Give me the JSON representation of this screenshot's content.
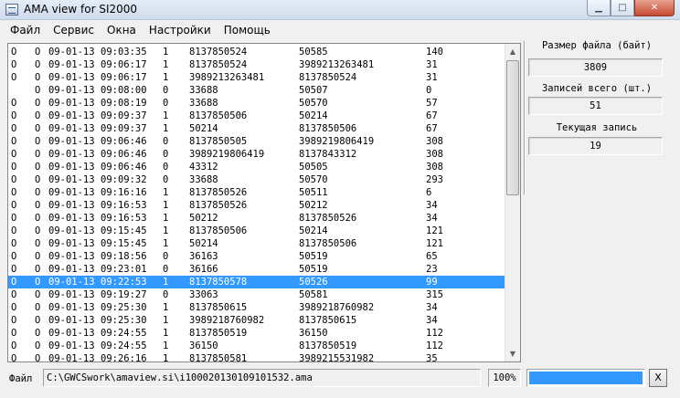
{
  "window": {
    "title": "AMA view for SI2000",
    "icon": "app-window-icon"
  },
  "menu": [
    "Файл",
    "Сервис",
    "Окна",
    "Настройки",
    "Помощь"
  ],
  "records": [
    [
      "O",
      "O",
      "09-01-13",
      "09:03:35",
      "1",
      "8137850524",
      "50585",
      "140"
    ],
    [
      "O",
      "O",
      "09-01-13",
      "09:06:17",
      "1",
      "8137850524",
      "3989213263481",
      "31"
    ],
    [
      "O",
      "O",
      "09-01-13",
      "09:06:17",
      "1",
      "3989213263481",
      "8137850524",
      "31"
    ],
    [
      "",
      "O",
      "09-01-13",
      "09:08:00",
      "0",
      "33688",
      "50507",
      "0"
    ],
    [
      "O",
      "O",
      "09-01-13",
      "09:08:19",
      "0",
      "33688",
      "50570",
      "57"
    ],
    [
      "O",
      "O",
      "09-01-13",
      "09:09:37",
      "1",
      "8137850506",
      "50214",
      "67"
    ],
    [
      "O",
      "O",
      "09-01-13",
      "09:09:37",
      "1",
      "50214",
      "8137850506",
      "67"
    ],
    [
      "O",
      "O",
      "09-01-13",
      "09:06:46",
      "0",
      "8137850505",
      "3989219806419",
      "308"
    ],
    [
      "O",
      "O",
      "09-01-13",
      "09:06:46",
      "0",
      "3989219806419",
      "8137843312",
      "308"
    ],
    [
      "O",
      "O",
      "09-01-13",
      "09:06:46",
      "0",
      "43312",
      "50505",
      "308"
    ],
    [
      "O",
      "O",
      "09-01-13",
      "09:09:32",
      "0",
      "33688",
      "50570",
      "293"
    ],
    [
      "O",
      "O",
      "09-01-13",
      "09:16:16",
      "1",
      "8137850526",
      "50511",
      "6"
    ],
    [
      "O",
      "O",
      "09-01-13",
      "09:16:53",
      "1",
      "8137850526",
      "50212",
      "34"
    ],
    [
      "O",
      "O",
      "09-01-13",
      "09:16:53",
      "1",
      "50212",
      "8137850526",
      "34"
    ],
    [
      "O",
      "O",
      "09-01-13",
      "09:15:45",
      "1",
      "8137850506",
      "50214",
      "121"
    ],
    [
      "O",
      "O",
      "09-01-13",
      "09:15:45",
      "1",
      "50214",
      "8137850506",
      "121"
    ],
    [
      "O",
      "O",
      "09-01-13",
      "09:18:56",
      "0",
      "36163",
      "50519",
      "65"
    ],
    [
      "O",
      "O",
      "09-01-13",
      "09:23:01",
      "0",
      "36166",
      "50519",
      "23"
    ],
    [
      "O",
      "O",
      "09-01-13",
      "09:22:53",
      "1",
      "8137850578",
      "50526",
      "99"
    ],
    [
      "O",
      "O",
      "09-01-13",
      "09:19:27",
      "0",
      "33063",
      "50581",
      "315"
    ],
    [
      "O",
      "O",
      "09-01-13",
      "09:25:30",
      "1",
      "8137850615",
      "3989218760982",
      "34"
    ],
    [
      "O",
      "O",
      "09-01-13",
      "09:25:30",
      "1",
      "3989218760982",
      "8137850615",
      "34"
    ],
    [
      "O",
      "O",
      "09-01-13",
      "09:24:55",
      "1",
      "8137850519",
      "36150",
      "112"
    ],
    [
      "O",
      "O",
      "09-01-13",
      "09:24:55",
      "1",
      "36150",
      "8137850519",
      "112"
    ],
    [
      "O",
      "O",
      "09-01-13",
      "09:26:16",
      "1",
      "8137850581",
      "3989215531982",
      "35"
    ]
  ],
  "selected_index": 18,
  "panel": {
    "file_size_label": "Размер файла (байт)",
    "file_size_value": "3809",
    "total_records_label": "Записей всего (шт.)",
    "total_records_value": "51",
    "current_record_label": "Текущая запись",
    "current_record_value": "19"
  },
  "status": {
    "file_label": "Файл",
    "file_path": "C:\\GWCSwork\\amaview.si\\i100020130109101532.ama",
    "percent": "100%",
    "progress_fraction": 1.0,
    "close_label": "X"
  },
  "colors": {
    "selection": "#3399ff",
    "progress": "#3399ff"
  }
}
